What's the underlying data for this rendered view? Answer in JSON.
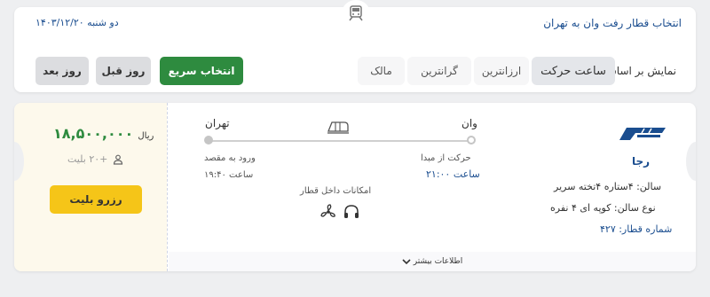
{
  "header": {
    "title": "انتخاب قطار رفت وان به تهران",
    "date": "دو شنبه ۱۴۰۳/۱۲/۲۰"
  },
  "sort": {
    "label": "نمایش بر اساس :",
    "options": [
      "ساعت حرکت",
      "ارزانترین",
      "گرانترین",
      "مالک"
    ]
  },
  "actions": {
    "quick_select": "انتخاب سریع",
    "prev_day": "روز قبل",
    "next_day": "روز بعد"
  },
  "result": {
    "company": "رجا",
    "wagon": "سالن: ۴ستاره ۴تخته سریر",
    "wagon_type": "نوع سالن: کوپه ای ۴ نفره",
    "train_number": "شماره قطار: ۴۲۷",
    "origin": "وان",
    "destination": "تهران",
    "departure_label": "حرکت از مبدا",
    "departure_time": "ساعت ۲۱:۰۰",
    "arrival_label": "ورود به مقصد",
    "arrival_time": "ساعت ۱۹:۴۰",
    "amenities_label": "امکانات داخل قطار",
    "more_info": "اطلاعات بیشتر",
    "price": "۱۸,۵۰۰,۰۰۰",
    "currency": "ریال",
    "seats": "+۲۰ بلیت",
    "reserve": "رزرو بلیت"
  },
  "colors": {
    "primary_blue": "#1a4d8f",
    "green": "#2e8b3f",
    "yellow": "#f5c518"
  },
  "icons": [
    "train-icon",
    "user-icon",
    "fan-icon",
    "headphones-icon",
    "chevron-down-icon",
    "raja-logo"
  ]
}
